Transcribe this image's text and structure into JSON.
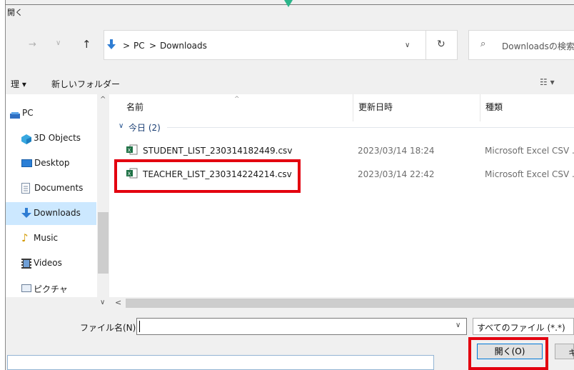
{
  "window": {
    "title": "開く"
  },
  "nav": {
    "back_icon": "back-arrow-icon",
    "forward_icon": "forward-arrow-icon",
    "recent_icon": "chevron-down-icon",
    "up_icon": "up-arrow-icon",
    "breadcrumb": [
      "PC",
      "Downloads"
    ],
    "breadcrumb_sep": ">",
    "search_placeholder": "Downloadsの検索"
  },
  "toolbar": {
    "organize_label": "理 ▾",
    "new_folder_label": "新しいフォルダー"
  },
  "sidebar": {
    "items": [
      {
        "label": "PC",
        "icon": "pc-icon"
      },
      {
        "label": "3D Objects",
        "icon": "cube-icon"
      },
      {
        "label": "Desktop",
        "icon": "desktop-icon"
      },
      {
        "label": "Documents",
        "icon": "document-icon"
      },
      {
        "label": "Downloads",
        "icon": "download-icon",
        "selected": true
      },
      {
        "label": "Music",
        "icon": "music-icon"
      },
      {
        "label": "Videos",
        "icon": "video-icon"
      },
      {
        "label": "ピクチャ",
        "icon": "picture-icon"
      }
    ]
  },
  "columns": {
    "name": "名前",
    "modified": "更新日時",
    "type": "種類"
  },
  "group": {
    "label": "今日 (2)"
  },
  "files": [
    {
      "name": "STUDENT_LIST_230314182449.csv",
      "modified": "2023/03/14 18:24",
      "type": "Microsoft Excel CSV ...",
      "icon": "excel-csv-icon"
    },
    {
      "name": "TEACHER_LIST_230314224214.csv",
      "modified": "2023/03/14 22:42",
      "type": "Microsoft Excel CSV ...",
      "icon": "excel-csv-icon",
      "highlighted": true
    }
  ],
  "footer": {
    "filename_label": "ファイル名(N):",
    "filename_value": "",
    "filetype_value": "すべてのファイル (*.*)",
    "open_button": "開く(O)",
    "cancel_button": "キ"
  },
  "colors": {
    "highlight": "#e3000f",
    "selection": "#cce8ff",
    "accent": "#0078d7"
  }
}
